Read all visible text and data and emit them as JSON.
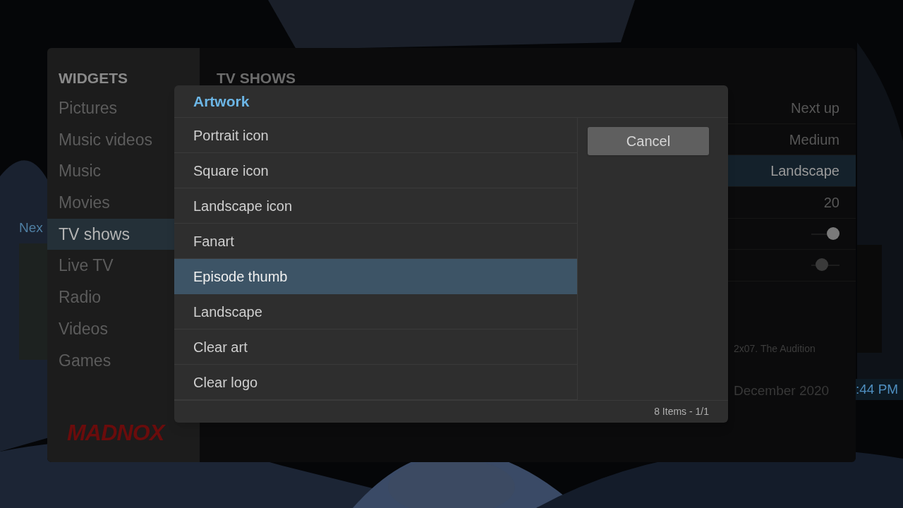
{
  "sidebar": {
    "heading": "WIDGETS",
    "items": [
      {
        "label": "Pictures",
        "selected": false
      },
      {
        "label": "Music videos",
        "selected": false
      },
      {
        "label": "Music",
        "selected": false
      },
      {
        "label": "Movies",
        "selected": false
      },
      {
        "label": "TV shows",
        "selected": true
      },
      {
        "label": "Live TV",
        "selected": false
      },
      {
        "label": "Radio",
        "selected": false
      },
      {
        "label": "Videos",
        "selected": false
      },
      {
        "label": "Games",
        "selected": false
      }
    ]
  },
  "logo": {
    "text": "MADNOX"
  },
  "settings": {
    "heading": "TV SHOWS",
    "rows": [
      {
        "kind": "value",
        "value": "Next up",
        "selected": false
      },
      {
        "kind": "value",
        "value": "Medium",
        "selected": false
      },
      {
        "kind": "value",
        "value": "Landscape",
        "selected": true
      },
      {
        "kind": "value",
        "value": "20",
        "selected": false
      },
      {
        "kind": "toggle",
        "on": true,
        "selected": false
      },
      {
        "kind": "toggle",
        "on": false,
        "selected": false
      }
    ]
  },
  "background": {
    "widget_label": "Nex",
    "episode": "2x07. The Audition",
    "date": "December 2020",
    "time": ":44 PM"
  },
  "dialog": {
    "title": "Artwork",
    "items": [
      {
        "label": "Portrait icon",
        "selected": false
      },
      {
        "label": "Square icon",
        "selected": false
      },
      {
        "label": "Landscape icon",
        "selected": false
      },
      {
        "label": "Fanart",
        "selected": false
      },
      {
        "label": "Episode thumb",
        "selected": true
      },
      {
        "label": "Landscape",
        "selected": false
      },
      {
        "label": "Clear art",
        "selected": false
      },
      {
        "label": "Clear logo",
        "selected": false
      }
    ],
    "buttons": [
      {
        "label": "Cancel"
      }
    ],
    "footer": "8 Items - 1/1"
  }
}
